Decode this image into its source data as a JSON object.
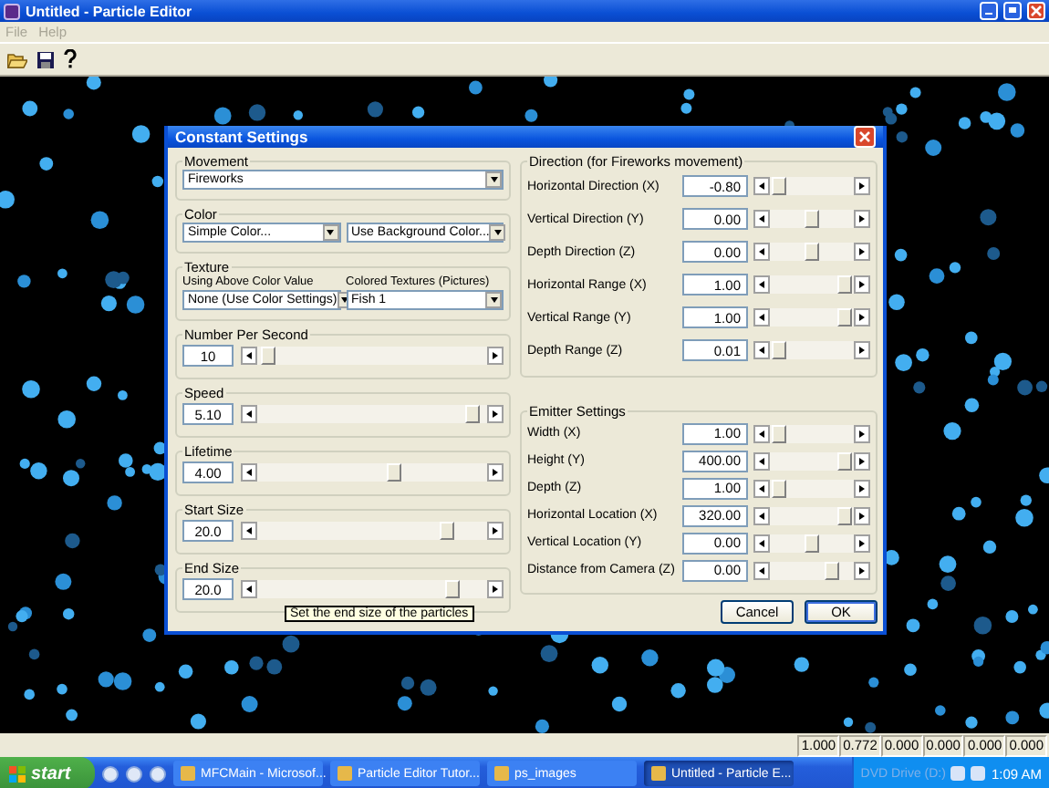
{
  "window": {
    "title": "Untitled - Particle Editor"
  },
  "menu": [
    {
      "label": "File",
      "disabled": true
    },
    {
      "label": "Help",
      "disabled": true
    }
  ],
  "dialog": {
    "title": "Constant Settings",
    "movement": {
      "label": "Movement",
      "dropdown": "Fireworks"
    },
    "color": {
      "label": "Color",
      "dropdowns": [
        "Simple Color...",
        "Use Background Color..."
      ]
    },
    "texture": {
      "label": "Texture",
      "columns": [
        {
          "label": "Using Above Color Value",
          "dropdown": "None (Use Color Settings)"
        },
        {
          "label": "Colored Textures (Pictures)",
          "dropdown": "Fish 1"
        }
      ]
    },
    "sliders": [
      {
        "label": "Number Per Second",
        "value": "10",
        "level": 0.02
      },
      {
        "label": "Speed",
        "value": "5.10",
        "level": 0.97
      },
      {
        "label": "Lifetime",
        "value": "4.00",
        "level": 0.6
      },
      {
        "label": "Start Size",
        "value": "20.0",
        "level": 0.85
      },
      {
        "label": "End Size",
        "value": "20.0",
        "level": 0.87
      }
    ],
    "tooltip": "Set the end size of the particles",
    "direction": {
      "title": "Direction (for Fireworks movement)",
      "rows": [
        {
          "label": "Horizontal Direction (X)",
          "value": "-0.80",
          "level": 0.02
        },
        {
          "label": "Vertical Direction (Y)",
          "value": "0.00",
          "level": 0.5
        },
        {
          "label": "Depth Direction (Z)",
          "value": "0.00",
          "level": 0.5
        },
        {
          "label": "Horizontal Range (X)",
          "value": "1.00",
          "level": 0.98
        },
        {
          "label": "Vertical Range (Y)",
          "value": "1.00",
          "level": 0.98
        },
        {
          "label": "Depth Range (Z)",
          "value": "0.01",
          "level": 0.02
        }
      ]
    },
    "emitter": {
      "title": "Emitter Settings",
      "rows": [
        {
          "label": "Width (X)",
          "value": "1.00",
          "level": 0.02
        },
        {
          "label": "Height (Y)",
          "value": "400.00",
          "level": 0.98
        },
        {
          "label": "Depth (Z)",
          "value": "1.00",
          "level": 0.02
        },
        {
          "label": "Horizontal Location (X)",
          "value": "320.00",
          "level": 0.98
        },
        {
          "label": "Vertical Location (Y)",
          "value": "0.00",
          "level": 0.5
        },
        {
          "label": "Distance from Camera (Z)",
          "value": "0.00",
          "level": 0.8
        }
      ]
    },
    "buttons": [
      {
        "label": "Cancel",
        "default": false
      },
      {
        "label": "OK",
        "default": true
      }
    ]
  },
  "status_bar": [
    "1.000",
    "0.772",
    "0.000",
    "0.000",
    "0.000",
    "0.000"
  ],
  "taskbar": {
    "start": "start",
    "tasks": [
      {
        "label": "MFCMain - Microsof...",
        "selected": false
      },
      {
        "label": "Particle Editor Tutor...",
        "selected": false
      },
      {
        "label": "ps_images",
        "selected": false
      },
      {
        "label": "Untitled - Particle E...",
        "selected": true
      }
    ],
    "tray_text": "DVD Drive (D:)",
    "clock": "1:09 AM"
  }
}
